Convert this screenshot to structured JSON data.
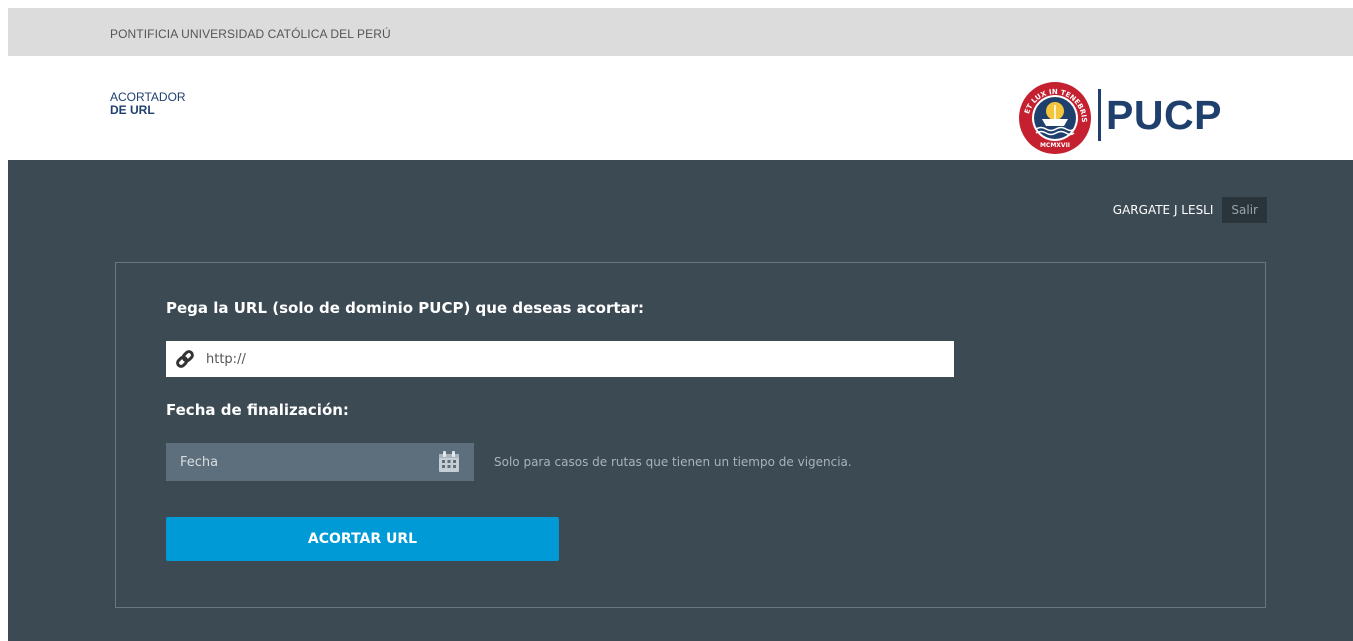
{
  "topbar": {
    "university": "PONTIFICIA UNIVERSIDAD CATÓLICA DEL PERÚ"
  },
  "header": {
    "brand_line1": "ACORTADOR",
    "brand_line2": "DE URL",
    "logo_text": "PUCP",
    "seal_motto": "ET LUX IN TENEBRIS LUCET",
    "seal_year": "MCMXVII"
  },
  "user": {
    "name": "GARGATE J LESLI",
    "logout_label": "Salir"
  },
  "form": {
    "url_label": "Pega la URL (solo de dominio PUCP) que deseas acortar:",
    "url_placeholder": "http://",
    "date_label": "Fecha de finalización:",
    "date_placeholder": "Fecha",
    "date_hint": "Solo para casos de rutas que tienen un tiempo de vigencia.",
    "submit_label": "ACORTAR URL"
  },
  "icons": {
    "url_field": "link-icon",
    "date_field": "calendar-icon",
    "logo": "pucp-seal-icon"
  },
  "colors": {
    "brand_navy": "#1f3f6d",
    "brand_red": "#c4202f",
    "background_dark": "#3c4a54",
    "accent_blue": "#009ad6",
    "topbar_gray": "#dcdcdc"
  }
}
